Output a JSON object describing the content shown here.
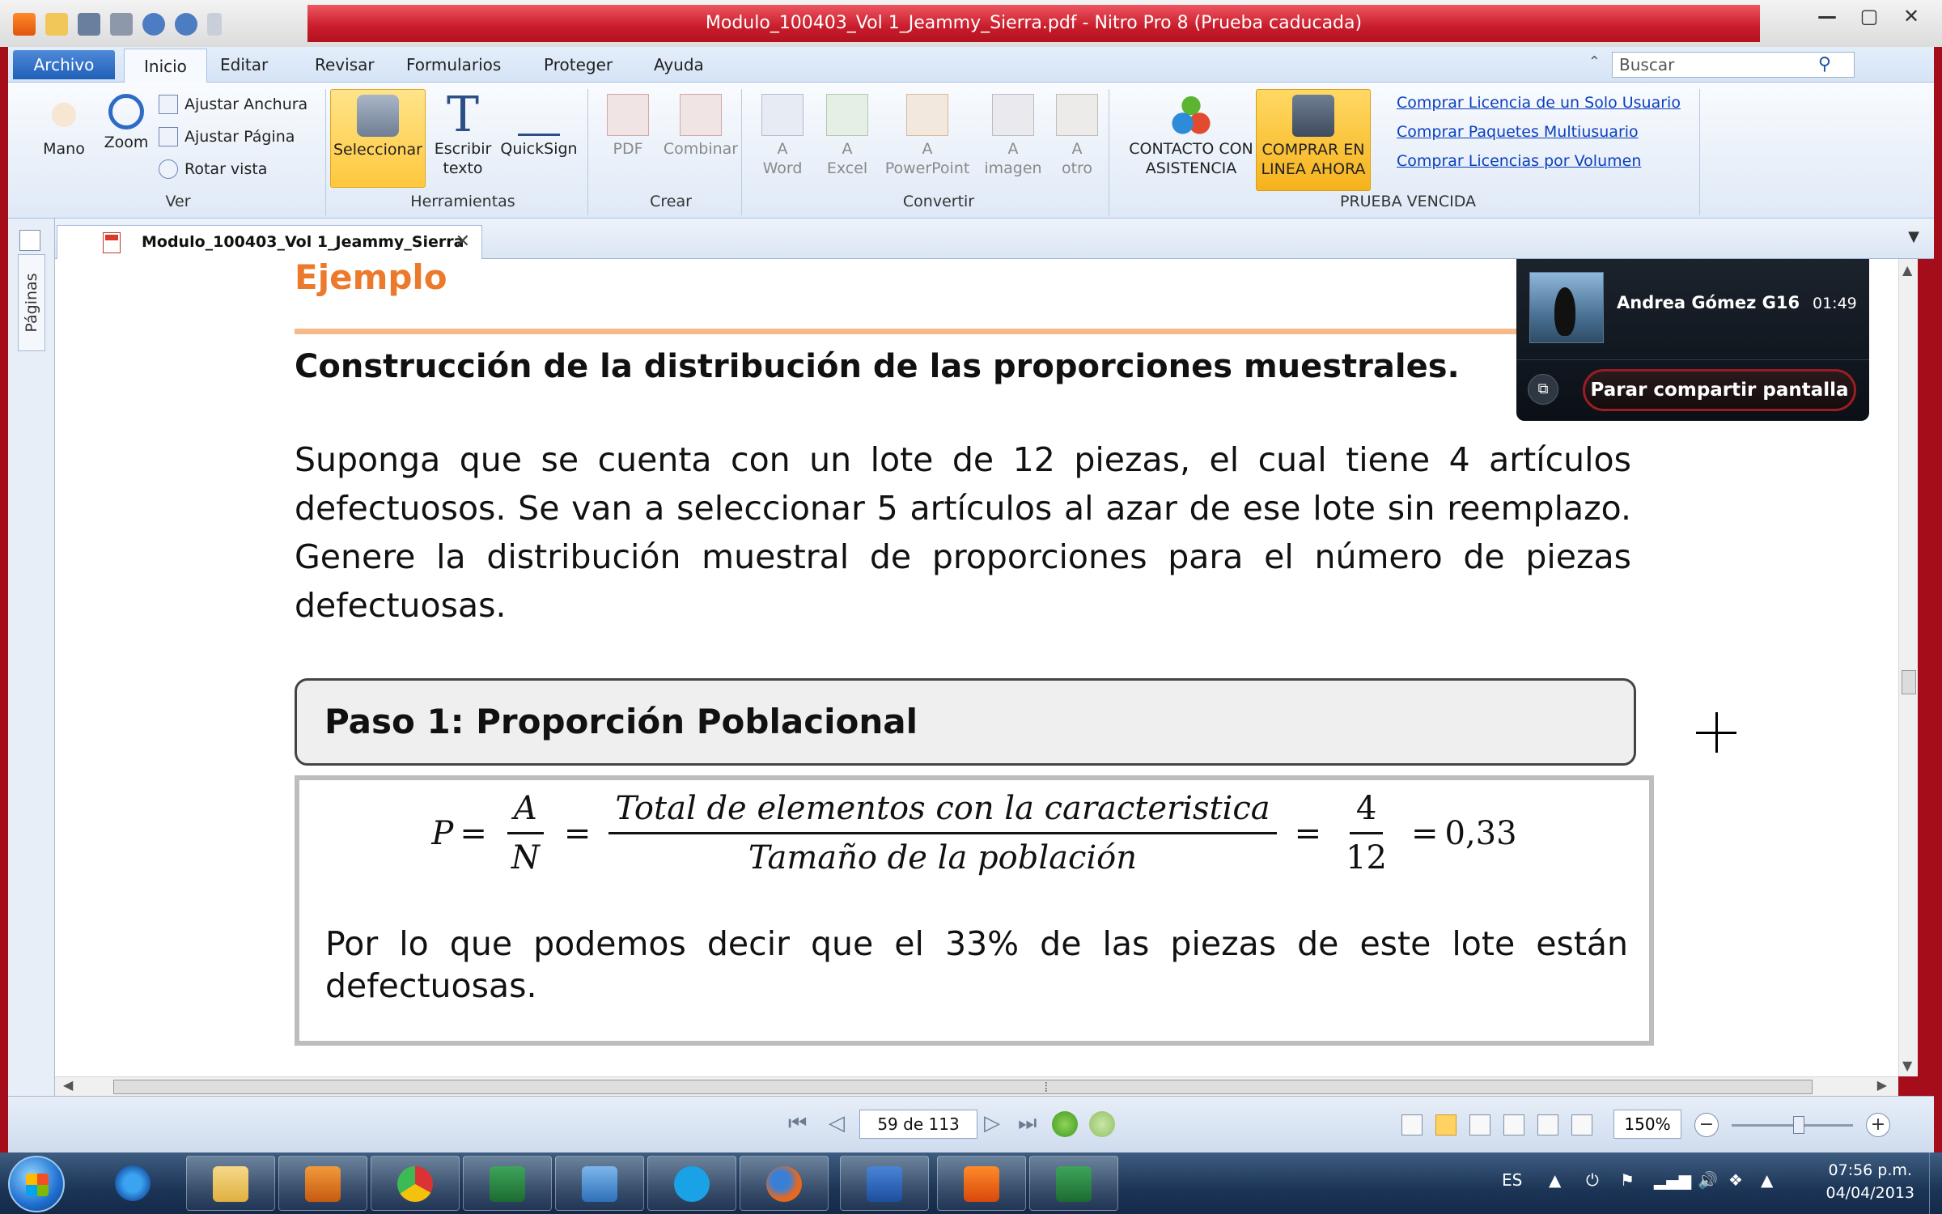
{
  "window": {
    "title": "Modulo_100403_Vol 1_Jeammy_Sierra.pdf - Nitro Pro 8 (Prueba caducada)",
    "minimize_label": "—",
    "maximize_label": "▢",
    "close_label": "✕"
  },
  "menu": {
    "archivo": "Archivo",
    "tabs": [
      "Inicio",
      "Editar",
      "Revisar",
      "Formularios",
      "Proteger",
      "Ayuda"
    ],
    "active_tab": "Inicio",
    "search_placeholder": "Buscar"
  },
  "ribbon": {
    "ver": {
      "label": "Ver",
      "mano": "Mano",
      "zoom": "Zoom",
      "ajustar_anchura": "Ajustar Anchura",
      "ajustar_pagina": "Ajustar Página",
      "rotar_vista": "Rotar vista"
    },
    "herramientas": {
      "label": "Herramientas",
      "seleccionar": "Seleccionar",
      "escribir_1": "Escribir",
      "escribir_2": "texto",
      "quicksign": "QuickSign"
    },
    "crear": {
      "label": "Crear",
      "pdf": "PDF",
      "combinar": "Combinar"
    },
    "convertir": {
      "label": "Convertir",
      "a": "A",
      "word": "Word",
      "excel": "Excel",
      "powerpoint": "PowerPoint",
      "imagen": "imagen",
      "otro": "otro"
    },
    "prueba": {
      "label": "PRUEBA VENCIDA",
      "contacto_1": "CONTACTO CON",
      "contacto_2": "ASISTENCIA",
      "comprar_1": "COMPRAR EN",
      "comprar_2": "LINEA AHORA",
      "links": [
        "Comprar Licencia de un Solo Usuario",
        "Comprar Paquetes Multiusuario",
        "Comprar Licencias por Volumen"
      ]
    }
  },
  "doc_tab": {
    "name": "Modulo_100403_Vol 1_Jeammy_Sierra",
    "close": "✕"
  },
  "left_panel": {
    "tab": "Páginas"
  },
  "document": {
    "heading": "Ejemplo",
    "subheading": "Construcción de la distribución de las proporciones muestrales.",
    "paragraph": "Suponga que se cuenta con un lote de 12 piezas, el cual tiene 4 artículos defectuosos. Se van a seleccionar 5 artículos al azar de ese lote sin reemplazo. Genere la distribución muestral de proporciones para el número de piezas defectuosas.",
    "step_title": "Paso 1: Proporción Poblacional",
    "formula": {
      "lhs": "P",
      "eq": "=",
      "frac1_num": "A",
      "frac1_den": "N",
      "frac2_num": "Total de elementos con la caracteristica",
      "frac2_den": "Tamaño de la población",
      "frac3_num": "4",
      "frac3_den": "12",
      "result": "0,33"
    },
    "conclusion": "Por lo que podemos decir que el 33% de las piezas de este lote están defectuosas."
  },
  "screen_share": {
    "user": "Andrea Gómez G16",
    "time": "01:49",
    "stop_label": "Parar compartir pantalla"
  },
  "status": {
    "page_indicator": "59 de 113",
    "zoom": "150%"
  },
  "taskbar": {
    "lang": "ES",
    "time": "07:56 p.m.",
    "date": "04/04/2013"
  },
  "icons": {
    "first_page": "⏮",
    "prev_page": "◁",
    "next_page": "▷",
    "last_page": "⏭"
  }
}
